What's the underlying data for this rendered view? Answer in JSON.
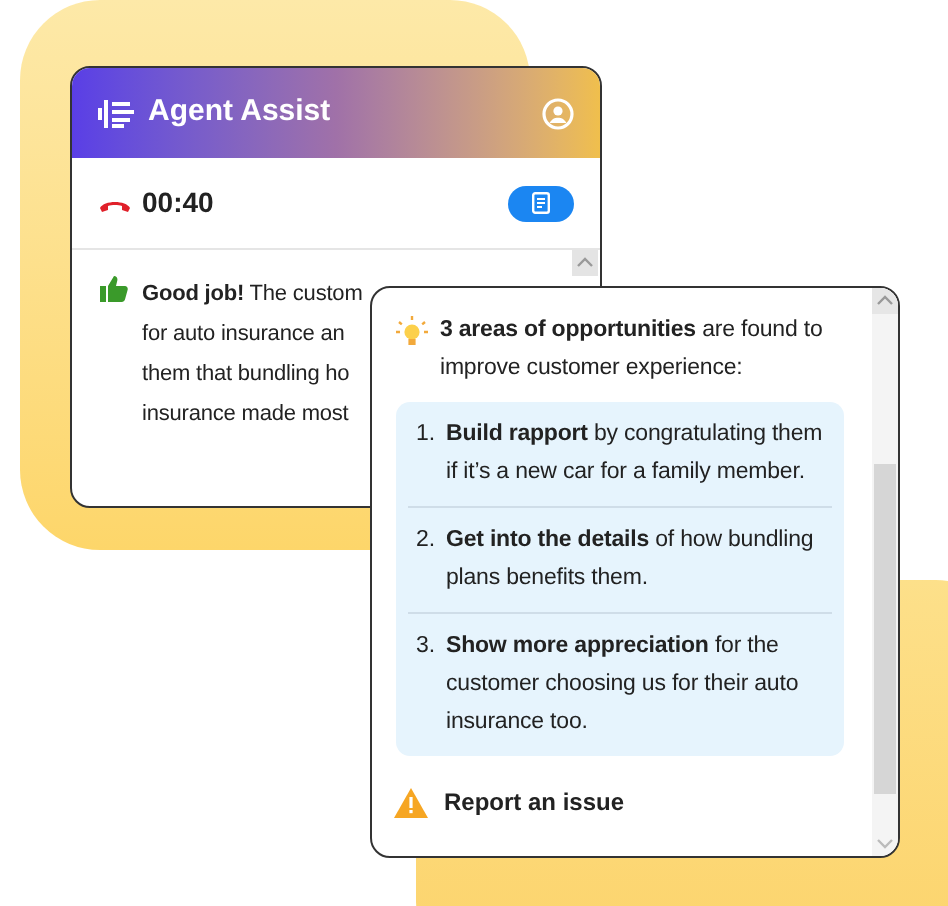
{
  "agent_window": {
    "title": "Agent Assist",
    "timer": "00:40",
    "feedback_lines": [
      "**Good job!** The custom",
      "for auto insurance an",
      "them that bundling ho",
      "insurance made most"
    ]
  },
  "opportunities_window": {
    "summary": "**3 areas of opportunities** are found to improve customer experience:",
    "items": [
      {
        "number": "1.",
        "text": "**Build rapport** by congratulating them if it’s a new car for a family member."
      },
      {
        "number": "2.",
        "text": "**Get into the details** of how bundling plans benefits them."
      },
      {
        "number": "3.",
        "text": "**Show more appreciation** for the customer choosing us for their auto insurance too."
      }
    ],
    "report_link": "Report an issue"
  }
}
